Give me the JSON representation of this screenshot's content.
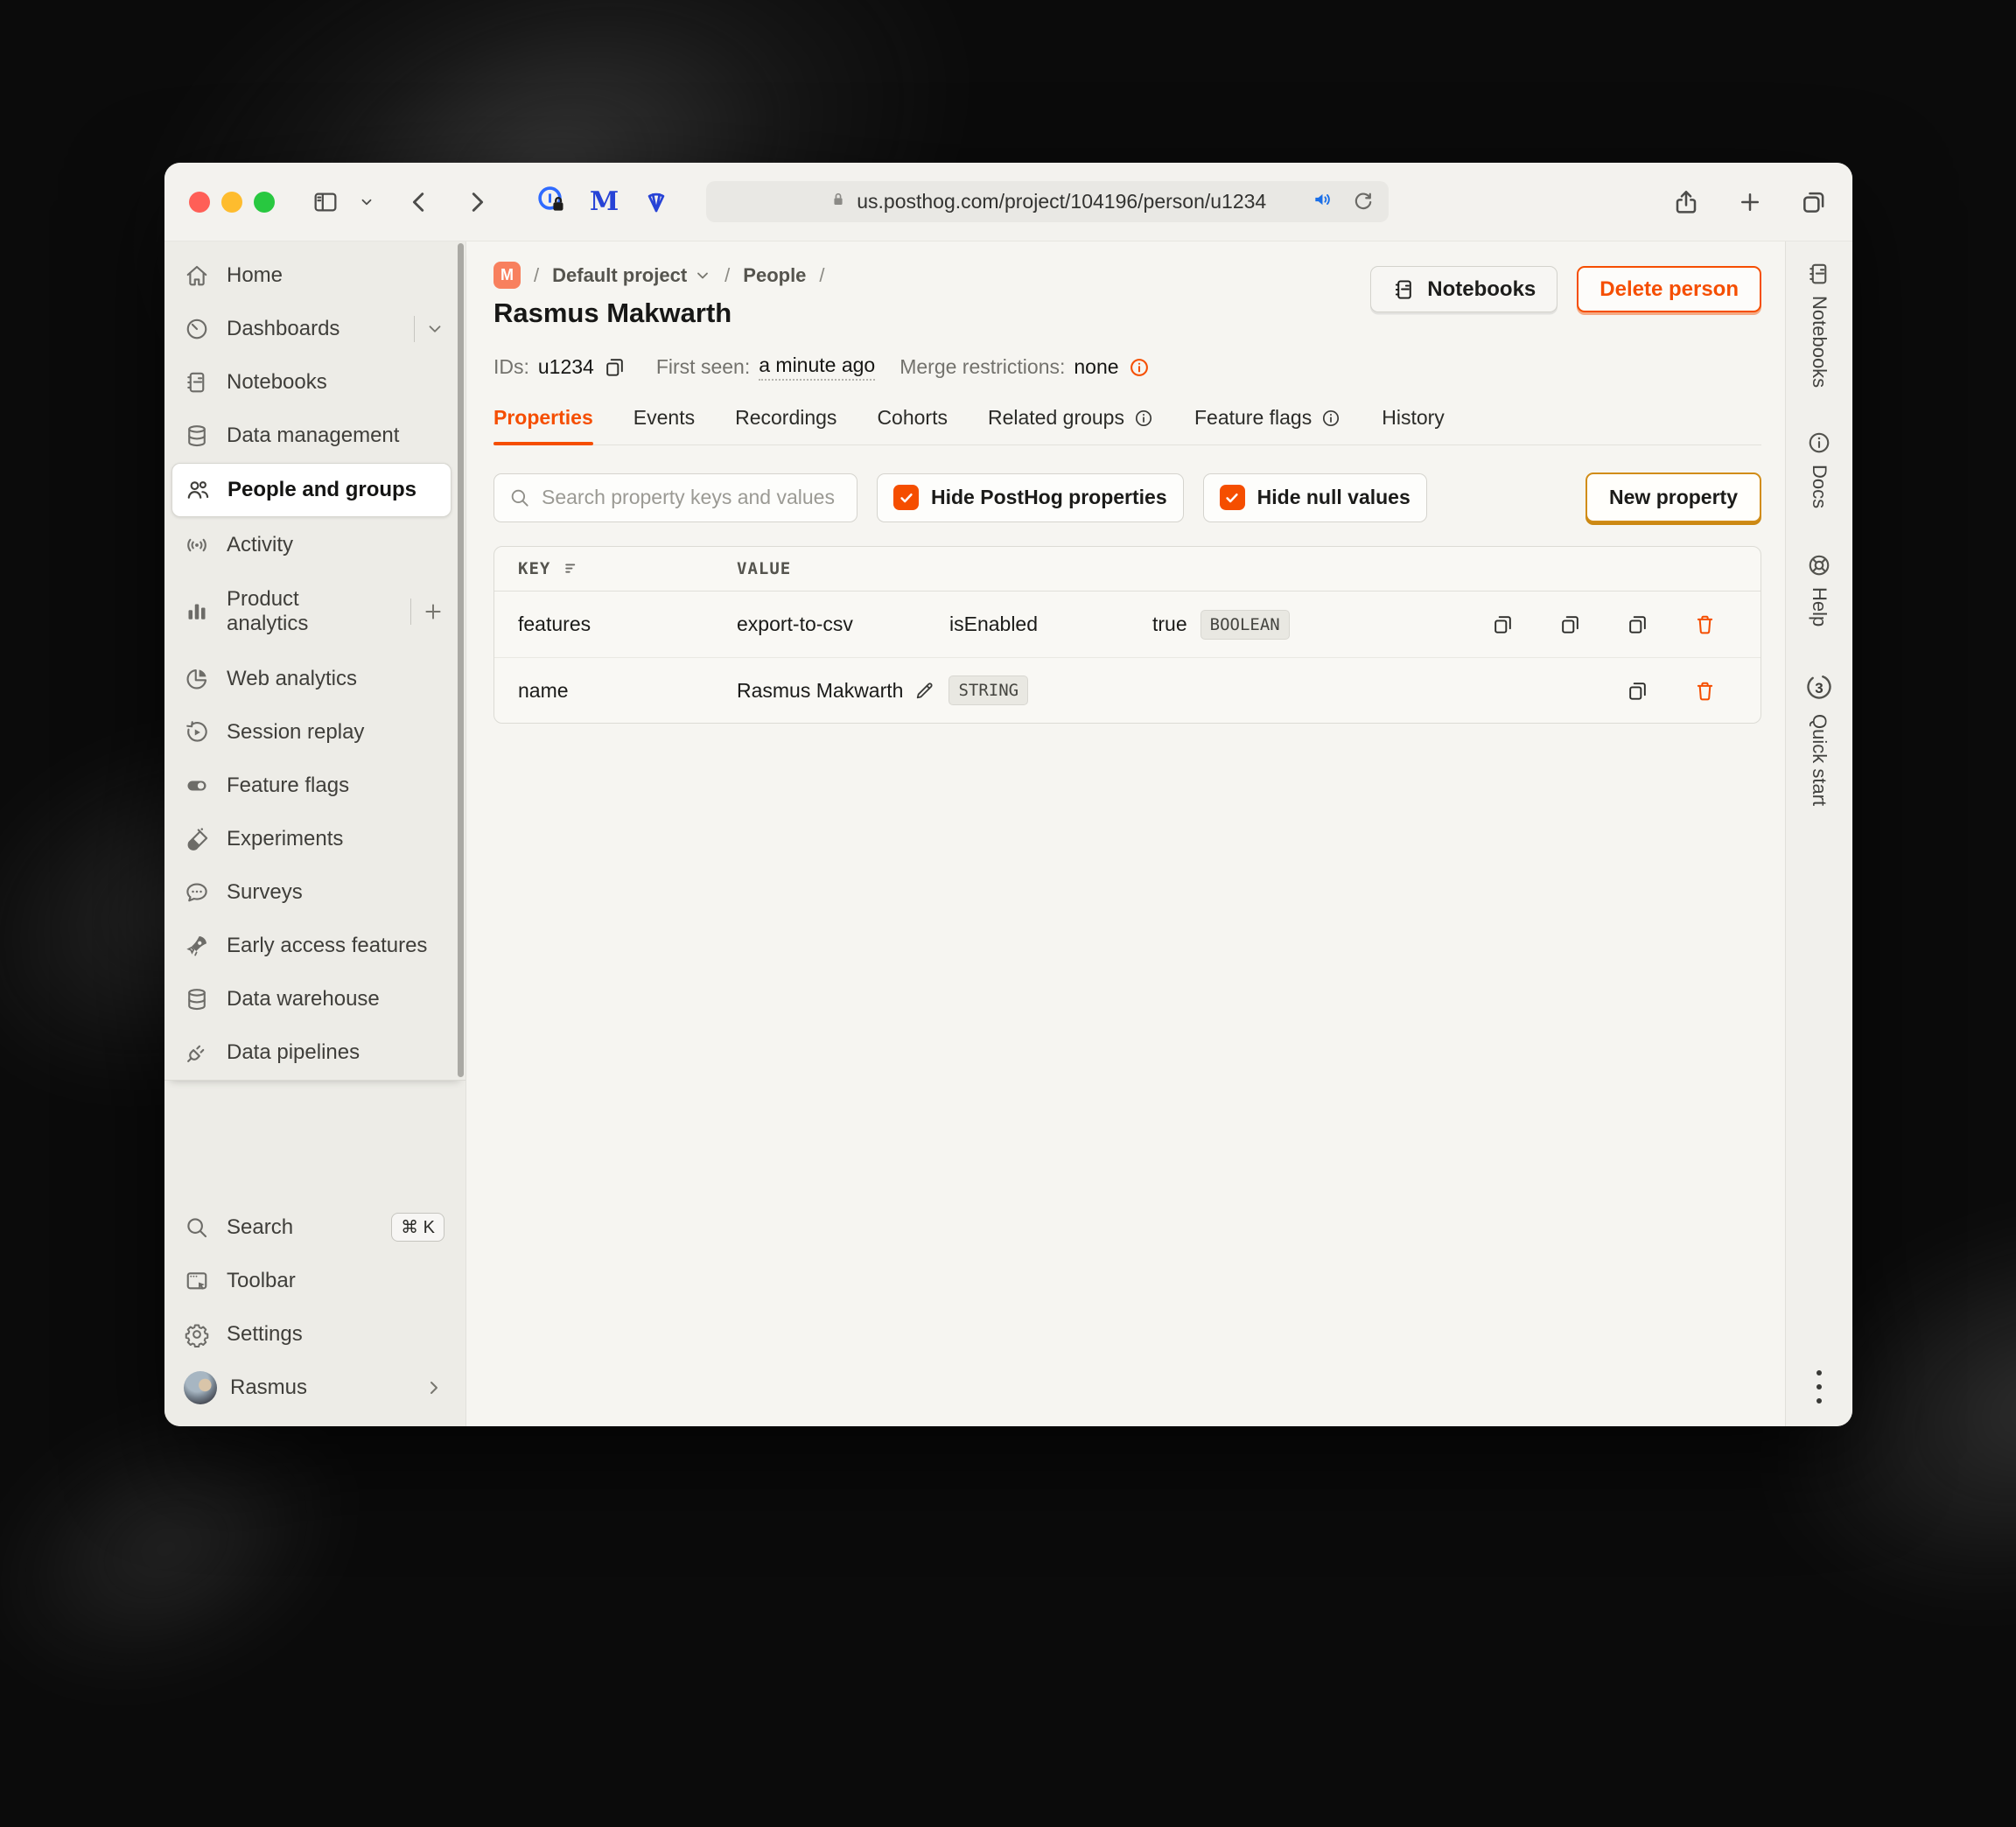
{
  "browser": {
    "url": "us.posthog.com/project/104196/person/u1234"
  },
  "header": {
    "project_initial": "M",
    "breadcrumbs": [
      {
        "label": "Default project"
      },
      {
        "label": "People"
      }
    ],
    "title": "Rasmus Makwarth",
    "notebooks_button": "Notebooks",
    "delete_button": "Delete person"
  },
  "meta": {
    "ids_label": "IDs:",
    "ids_value": "u1234",
    "first_seen_label": "First seen:",
    "first_seen_value": "a minute ago",
    "merge_label": "Merge restrictions:",
    "merge_value": "none"
  },
  "tabs": [
    {
      "label": "Properties",
      "active": true
    },
    {
      "label": "Events"
    },
    {
      "label": "Recordings"
    },
    {
      "label": "Cohorts"
    },
    {
      "label": "Related groups",
      "info": true
    },
    {
      "label": "Feature flags",
      "info": true
    },
    {
      "label": "History"
    }
  ],
  "filters": {
    "search_placeholder": "Search property keys and values",
    "hide_posthog": "Hide PostHog properties",
    "hide_null": "Hide null values",
    "new_property": "New property"
  },
  "table": {
    "key_header": "KEY",
    "value_header": "VALUE",
    "rows": [
      {
        "key": "features",
        "values": [
          "export-to-csv",
          "isEnabled",
          "true"
        ],
        "type": "BOOLEAN"
      },
      {
        "key": "name",
        "value": "Rasmus Makwarth",
        "type": "STRING"
      }
    ]
  },
  "sidebar": {
    "items": [
      {
        "label": "Home",
        "icon": "home-icon"
      },
      {
        "label": "Dashboards",
        "icon": "gauge-icon"
      },
      {
        "label": "Notebooks",
        "icon": "notebook-icon"
      },
      {
        "label": "Data management",
        "icon": "database-icon"
      },
      {
        "label": "People and groups",
        "icon": "people-icon",
        "selected": true
      },
      {
        "label": "Activity",
        "icon": "signal-icon"
      },
      {
        "label": "Product analytics",
        "icon": "bar-chart-icon"
      },
      {
        "label": "Web analytics",
        "icon": "pie-chart-icon"
      },
      {
        "label": "Session replay",
        "icon": "replay-icon"
      },
      {
        "label": "Feature flags",
        "icon": "toggle-icon"
      },
      {
        "label": "Experiments",
        "icon": "test-tube-icon"
      },
      {
        "label": "Surveys",
        "icon": "chat-bubble-icon"
      },
      {
        "label": "Early access features",
        "icon": "rocket-icon"
      },
      {
        "label": "Data warehouse",
        "icon": "database-icon"
      },
      {
        "label": "Data pipelines",
        "icon": "plug-icon"
      }
    ],
    "bottom": {
      "search": {
        "label": "Search",
        "shortcut": "⌘ K"
      },
      "toolbar": {
        "label": "Toolbar"
      },
      "settings": {
        "label": "Settings"
      },
      "user": {
        "label": "Rasmus"
      }
    }
  },
  "rail": {
    "items": [
      {
        "label": "Notebooks"
      },
      {
        "label": "Docs"
      },
      {
        "label": "Help"
      },
      {
        "label": "Quick start",
        "count": "3"
      }
    ]
  },
  "colors": {
    "accent": "#f54e00",
    "project_badge": "#f8805e",
    "new_property_border": "#d18c17"
  }
}
